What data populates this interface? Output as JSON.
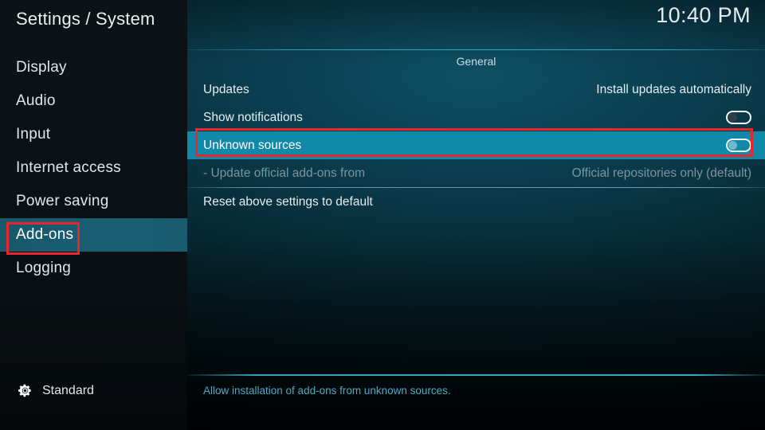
{
  "header": {
    "title": "Settings / System",
    "clock": "10:40 PM"
  },
  "sidebar": {
    "items": [
      {
        "label": "Display",
        "selected": false
      },
      {
        "label": "Audio",
        "selected": false
      },
      {
        "label": "Input",
        "selected": false
      },
      {
        "label": "Internet access",
        "selected": false
      },
      {
        "label": "Power saving",
        "selected": false
      },
      {
        "label": "Add-ons",
        "selected": true
      },
      {
        "label": "Logging",
        "selected": false
      }
    ],
    "settings_level": {
      "icon": "gear-icon",
      "label": "Standard"
    }
  },
  "main": {
    "group_header": "General",
    "rows": [
      {
        "label": "Updates",
        "value": "Install updates automatically",
        "control": "text",
        "state": "normal"
      },
      {
        "label": "Show notifications",
        "value": "",
        "control": "toggle",
        "toggle_on": false,
        "state": "normal"
      },
      {
        "label": "Unknown sources",
        "value": "",
        "control": "toggle",
        "toggle_on": false,
        "state": "focused"
      },
      {
        "label": "- Update official add-ons from",
        "value": "Official repositories only (default)",
        "control": "text",
        "state": "disabled"
      },
      {
        "label": "Reset above settings to default",
        "value": "",
        "control": "none",
        "state": "normal"
      }
    ],
    "help_text": "Allow installation of add-ons from unknown sources."
  },
  "colors": {
    "focus_row": "#1189a9",
    "sidebar_selected": "#1a5c70",
    "annotation": "#e8262c",
    "help_text": "#4fa9c6",
    "disabled_text": "#7d949c"
  }
}
